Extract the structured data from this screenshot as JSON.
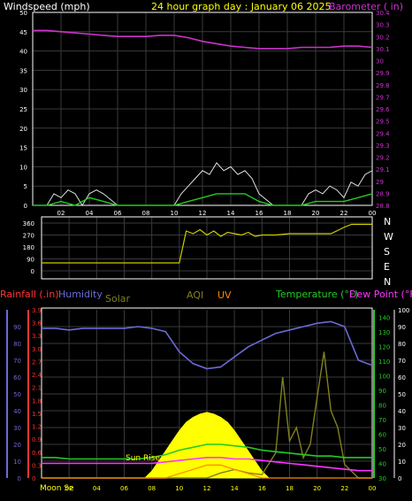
{
  "header": {
    "windspeed_label": "Windspeed (mph)",
    "title": "24 hour graph day : January 06 2025",
    "barometer_label": "Barometer ( in)"
  },
  "colors": {
    "background": "#000000",
    "grid": "#3a3a3a",
    "axis": "#ffffff",
    "barometer": "#cc33cc",
    "wind_gust": "#e0e0e0",
    "wind_avg": "#22cc22",
    "direction": "#cccc00",
    "humidity": "#6a6ad8",
    "temperature": "#22cc22",
    "dewpoint": "#ff33ff",
    "solar": "#ffff00",
    "uv": "#ff8800",
    "aqi": "#808020",
    "rainfall": "#ff3333",
    "sunrise": "#ffff00"
  },
  "middle": {
    "direction_ticks": [
      "360",
      "270",
      "180",
      "90",
      "0"
    ],
    "compass": [
      "N",
      "W",
      "S",
      "E",
      "N"
    ]
  },
  "bottom_header": {
    "rainfall": "Rainfall (.in)",
    "humidity": "Humidity",
    "solar": "Solar",
    "aqi": "AQI",
    "uv": "UV",
    "temperature": "Temperature (°F)",
    "dewpoint": "Dew Point (°F)"
  },
  "annotations": {
    "sun_rise": "Sun Rise",
    "moon_set": "Moon Se"
  },
  "chart_data": [
    {
      "type": "line",
      "id": "wind-barometer",
      "title": "24 hour graph day : January 06 2025",
      "x_ticks": [
        "02",
        "04",
        "06",
        "08",
        "10",
        "12",
        "14",
        "16",
        "18",
        "20",
        "22",
        "00"
      ],
      "left_axis": {
        "label": "Windspeed (mph)",
        "ylim": [
          0,
          50
        ],
        "ticks": [
          "0",
          "5",
          "10",
          "15",
          "20",
          "25",
          "30",
          "35",
          "40",
          "45",
          "50"
        ]
      },
      "right_axis": {
        "label": "Barometer ( in)",
        "ylim": [
          28.8,
          30.4
        ],
        "ticks": [
          "28.8",
          "28.9",
          "29",
          "29.1",
          "29.2",
          "29.3",
          "29.4",
          "29.5",
          "29.6",
          "29.7",
          "29.8",
          "29.9",
          "30",
          "30.1",
          "30.2",
          "30.3",
          "30.4"
        ]
      },
      "series": [
        {
          "name": "Barometer",
          "axis": "right",
          "x": [
            0,
            1,
            2,
            3,
            4,
            5,
            6,
            7,
            8,
            9,
            10,
            11,
            12,
            13,
            14,
            15,
            16,
            17,
            18,
            19,
            20,
            21,
            22,
            23,
            24
          ],
          "values": [
            30.25,
            30.25,
            30.24,
            30.23,
            30.22,
            30.21,
            30.2,
            30.2,
            30.2,
            30.21,
            30.21,
            30.19,
            30.16,
            30.14,
            30.12,
            30.11,
            30.1,
            30.1,
            30.1,
            30.11,
            30.11,
            30.11,
            30.12,
            30.12,
            30.11
          ]
        },
        {
          "name": "Gust",
          "axis": "left",
          "x": [
            0,
            1,
            1.5,
            2,
            2.5,
            3,
            3.5,
            4,
            4.5,
            5,
            6,
            7,
            8,
            9,
            10,
            10.5,
            11,
            11.5,
            12,
            12.5,
            13,
            13.5,
            14,
            14.5,
            15,
            15.5,
            16,
            17,
            18,
            19,
            19.5,
            20,
            20.5,
            21,
            21.5,
            22,
            22.5,
            23,
            23.5,
            24
          ],
          "values": [
            0,
            0,
            3,
            2,
            4,
            3,
            0,
            3,
            4,
            3,
            0,
            0,
            0,
            0,
            0,
            3,
            5,
            7,
            9,
            8,
            11,
            9,
            10,
            8,
            9,
            7,
            3,
            0,
            0,
            0,
            3,
            4,
            3,
            5,
            4,
            2,
            6,
            5,
            8,
            9
          ]
        },
        {
          "name": "Average",
          "axis": "left",
          "x": [
            0,
            1,
            2,
            3,
            4,
            5,
            6,
            7,
            8,
            9,
            10,
            11,
            12,
            13,
            14,
            15,
            16,
            17,
            18,
            19,
            20,
            21,
            22,
            23,
            24
          ],
          "values": [
            0,
            0,
            1,
            0,
            2,
            1,
            0,
            0,
            0,
            0,
            0,
            1,
            2,
            3,
            3,
            3,
            1,
            0,
            0,
            0,
            1,
            1,
            1,
            2,
            3
          ]
        }
      ]
    },
    {
      "type": "line",
      "id": "wind-direction",
      "ylim": [
        0,
        360
      ],
      "ticks": [
        "360",
        "270",
        "180",
        "90",
        "0"
      ],
      "series": [
        {
          "name": "Direction",
          "x": [
            0,
            1,
            2,
            3,
            4,
            5,
            6,
            7,
            8,
            9,
            10,
            10.5,
            11,
            11.5,
            12,
            12.5,
            13,
            13.5,
            14,
            14.5,
            15,
            15.5,
            16,
            17,
            18,
            19,
            20,
            21,
            22,
            22.5,
            23,
            24
          ],
          "values": [
            60,
            60,
            60,
            60,
            60,
            60,
            60,
            60,
            60,
            60,
            60,
            300,
            280,
            310,
            270,
            300,
            260,
            290,
            280,
            270,
            290,
            260,
            270,
            270,
            280,
            280,
            280,
            280,
            330,
            350,
            350,
            350
          ]
        }
      ]
    },
    {
      "type": "line",
      "id": "weather-bottom",
      "x_ticks": [
        "02",
        "04",
        "06",
        "08",
        "10",
        "12",
        "14",
        "16",
        "18",
        "20",
        "22",
        "00"
      ],
      "humidity_axis": {
        "ylim": [
          0,
          100
        ],
        "ticks": [
          "0",
          "10",
          "20",
          "30",
          "40",
          "50",
          "60",
          "70",
          "80",
          "90"
        ]
      },
      "rainfall_axis": {
        "ylim": [
          0,
          3.9
        ],
        "ticks": [
          "0",
          "0.3",
          "0.6",
          "0.9",
          "1.2",
          "1.5",
          "1.8",
          "2.1",
          "2.4",
          "2.7",
          "3.0",
          "3.3",
          "3.6",
          "3.9"
        ]
      },
      "temperature_axis": {
        "ylim": [
          30,
          145
        ],
        "ticks": [
          "30",
          "40",
          "50",
          "60",
          "70",
          "80",
          "90",
          "100",
          "110",
          "120",
          "130",
          "140"
        ]
      },
      "right_axis": {
        "ylim": [
          0,
          100
        ],
        "ticks": [
          "0",
          "10",
          "20",
          "30",
          "40",
          "50",
          "60",
          "70",
          "80",
          "90",
          "100"
        ]
      },
      "series": [
        {
          "name": "Humidity",
          "x": [
            0,
            1,
            2,
            3,
            4,
            5,
            6,
            7,
            8,
            9,
            10,
            11,
            12,
            13,
            14,
            15,
            16,
            17,
            18,
            19,
            20,
            21,
            22,
            23,
            24
          ],
          "values": [
            89,
            89,
            88,
            89,
            89,
            89,
            89,
            90,
            89,
            87,
            75,
            68,
            65,
            66,
            72,
            78,
            82,
            86,
            88,
            90,
            92,
            93,
            90,
            70,
            67
          ]
        },
        {
          "name": "Temperature",
          "x": [
            0,
            1,
            2,
            3,
            4,
            5,
            6,
            7,
            8,
            9,
            10,
            11,
            12,
            13,
            14,
            15,
            16,
            17,
            18,
            19,
            20,
            21,
            22,
            23,
            24
          ],
          "values": [
            44,
            44,
            43,
            43,
            43,
            43,
            43,
            43,
            44,
            46,
            49,
            51,
            53,
            53,
            52,
            51,
            49,
            48,
            47,
            46,
            45,
            45,
            44,
            44,
            44
          ]
        },
        {
          "name": "Dew Point",
          "x": [
            0,
            1,
            2,
            3,
            4,
            5,
            6,
            7,
            8,
            9,
            10,
            11,
            12,
            13,
            14,
            15,
            16,
            17,
            18,
            19,
            20,
            21,
            22,
            23,
            24
          ],
          "values": [
            40,
            40,
            40,
            40,
            40,
            40,
            40,
            40,
            40,
            41,
            42,
            43,
            44,
            44,
            43,
            43,
            42,
            41,
            40,
            39,
            38,
            37,
            36,
            35,
            35
          ]
        },
        {
          "name": "Solar",
          "x": [
            7.5,
            8,
            8.5,
            9,
            9.5,
            10,
            10.5,
            11,
            11.5,
            12,
            12.5,
            13,
            13.5,
            14,
            14.5,
            15,
            15.5,
            16,
            16.5
          ],
          "values": [
            0,
            4,
            10,
            16,
            22,
            28,
            33,
            36,
            38,
            39,
            38,
            36,
            33,
            28,
            22,
            16,
            10,
            4,
            0
          ]
        },
        {
          "name": "AQI",
          "x": [
            0,
            8,
            12,
            13,
            14,
            15,
            16,
            17,
            17.5,
            18,
            18.5,
            19,
            19.5,
            20,
            20.5,
            21,
            21.5,
            22,
            23,
            24
          ],
          "values": [
            0,
            0,
            0,
            3,
            5,
            3,
            2,
            15,
            60,
            22,
            30,
            12,
            20,
            48,
            75,
            40,
            30,
            8,
            0,
            0
          ]
        },
        {
          "name": "UV",
          "x": [
            0,
            9,
            10,
            11,
            12,
            13,
            14,
            15,
            16,
            17,
            24
          ],
          "values": [
            0,
            0,
            0.1,
            0.2,
            0.3,
            0.3,
            0.2,
            0.1,
            0,
            0,
            0
          ]
        }
      ]
    }
  ]
}
